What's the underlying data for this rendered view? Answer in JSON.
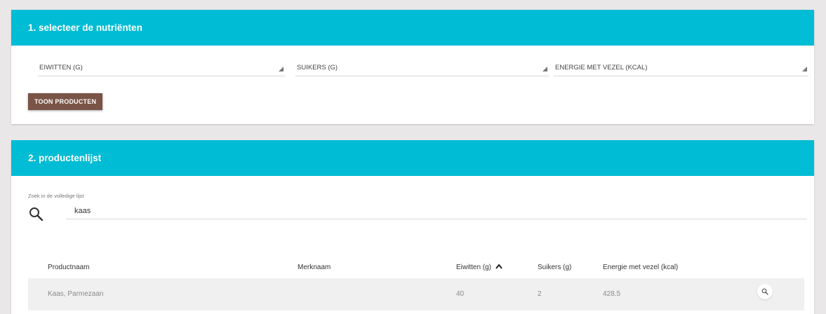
{
  "section1": {
    "title": "1. selecteer de nutriënten",
    "selects": [
      "EIWITTEN (G)",
      "SUIKERS (G)",
      "ENERGIE MET VEZEL (KCAL)"
    ],
    "button_label": "TOON PRODUCTEN"
  },
  "section2": {
    "title": "2. productenlijst",
    "search": {
      "caption": "Zoek in de volledige lijst",
      "value": "kaas"
    },
    "table": {
      "columns": [
        "Productnaam",
        "Merknaam",
        "Eiwitten (g)",
        "Suikers (g)",
        "Energie met vezel (kcal)"
      ],
      "sort_column": "Eiwitten (g)",
      "sort_direction": "ascending",
      "rows": [
        {
          "product": "Kaas, Parmezaan",
          "brand": "",
          "eiwitten": "40",
          "suikers": "2",
          "energie": "428.5"
        }
      ]
    }
  },
  "colors": {
    "header": "#00bcd4",
    "button": "#7a5446",
    "background": "#e9e7e7"
  },
  "icons": {
    "search": "search-icon",
    "sort": "chevron-up-icon",
    "row_action": "search-icon"
  }
}
